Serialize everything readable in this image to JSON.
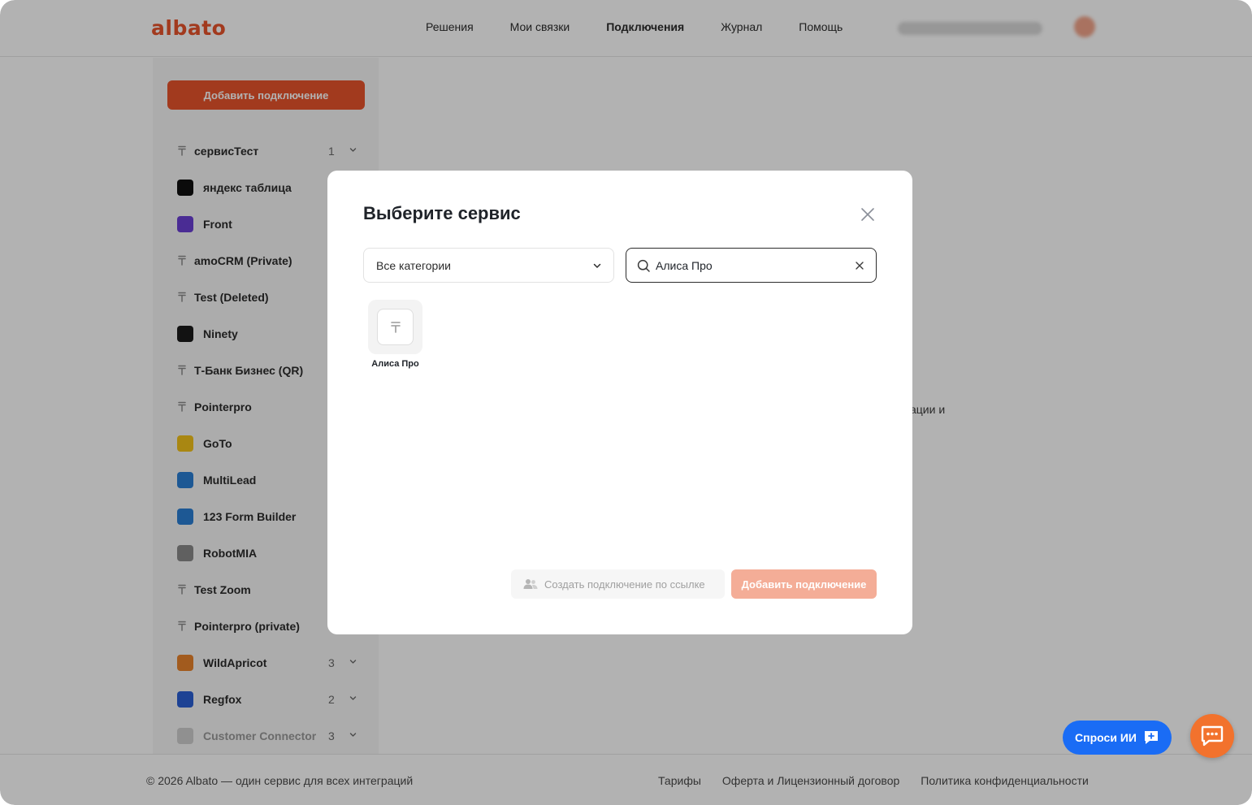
{
  "header": {
    "logo": "albato",
    "nav": [
      "Решения",
      "Мои связки",
      "Подключения",
      "Журнал",
      "Помощь"
    ],
    "active_nav": "Подключения"
  },
  "sidebar": {
    "add_button": "Добавить подключение",
    "items": [
      {
        "label": "сервисТест",
        "count": "1",
        "icon": "generic-t-icon",
        "expandable": true
      },
      {
        "label": "яндекс таблица",
        "icon": "tiktok-icon",
        "color": "#111111"
      },
      {
        "label": "Front",
        "icon": "front-icon",
        "color": "#6b3fd4"
      },
      {
        "label": "amoCRM (Private)",
        "icon": "generic-t-icon"
      },
      {
        "label": "Test (Deleted)",
        "icon": "generic-t-icon"
      },
      {
        "label": "Ninety",
        "icon": "ninety-icon",
        "color": "#1a1a1a"
      },
      {
        "label": "Т-Банк Бизнес (QR)",
        "icon": "generic-t-icon"
      },
      {
        "label": "Pointerpro",
        "icon": "generic-t-icon"
      },
      {
        "label": "GoTo",
        "icon": "goto-icon",
        "color": "#f2c21b"
      },
      {
        "label": "MultiLead",
        "icon": "multilead-icon",
        "color": "#2a7fd4"
      },
      {
        "label": "123 Form Builder",
        "icon": "form-builder-icon",
        "color": "#2a7fd4"
      },
      {
        "label": "RobotMIA",
        "icon": "robotmia-icon",
        "color": "#8a8a8a"
      },
      {
        "label": "Test Zoom",
        "icon": "generic-t-icon"
      },
      {
        "label": "Pointerpro (private)",
        "icon": "generic-t-icon"
      },
      {
        "label": "WildApricot",
        "count": "3",
        "icon": "wildapricot-icon",
        "color": "#e8832b",
        "expandable": true
      },
      {
        "label": "Regfox",
        "count": "2",
        "icon": "regfox-icon",
        "color": "#2a5fd4",
        "expandable": true
      },
      {
        "label": "Customer Connector",
        "count": "3",
        "icon": "customer-connector-icon",
        "color": "#cfcfcf",
        "expandable": true,
        "faded": true
      }
    ]
  },
  "main": {
    "bg_text": "ации и"
  },
  "modal": {
    "title": "Выберите сервис",
    "category": "Все категории",
    "search_value": "Алиса Про",
    "results": [
      {
        "name": "Алиса Про"
      }
    ],
    "link_button": "Создать подключение по ссылке",
    "add_button": "Добавить подключение"
  },
  "footer": {
    "copyright": "© 2026 Albato — один сервис для всех интеграций",
    "links": [
      "Тарифы",
      "Оферта и Лицензионный договор",
      "Политика конфиденциальности"
    ]
  },
  "floating": {
    "ai_button": "Спроси ИИ"
  },
  "colors": {
    "brand": "#e8532b",
    "ai_blue": "#1a6cf5",
    "chat_orange": "#f2722d",
    "disabled_add": "#f4ad97"
  }
}
